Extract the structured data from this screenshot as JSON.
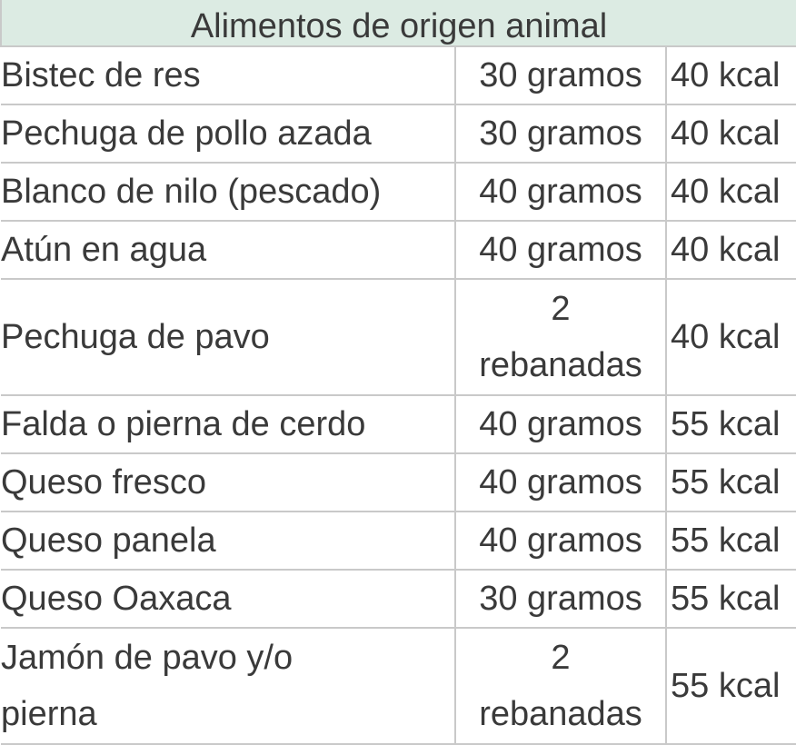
{
  "table": {
    "header": "Alimentos de origen animal",
    "rows": [
      {
        "name": "Bistec de res",
        "quantity": "30 gramos",
        "kcal": "40 kcal"
      },
      {
        "name": "Pechuga de pollo azada",
        "quantity": "30 gramos",
        "kcal": "40 kcal"
      },
      {
        "name": "Blanco de nilo (pescado)",
        "quantity": "40 gramos",
        "kcal": "40 kcal"
      },
      {
        "name": "Atún en agua",
        "quantity": "40 gramos",
        "kcal": "40 kcal"
      },
      {
        "name": "Pechuga de pavo",
        "quantity_line1": "2",
        "quantity_line2": "rebanadas",
        "kcal": "40 kcal"
      },
      {
        "name": "Falda o pierna de cerdo",
        "quantity": "40 gramos",
        "kcal": "55 kcal"
      },
      {
        "name": "Queso fresco",
        "quantity": "40 gramos",
        "kcal": "55 kcal"
      },
      {
        "name": "Queso panela",
        "quantity": "40 gramos",
        "kcal": "55 kcal"
      },
      {
        "name": "Queso Oaxaca",
        "quantity": "30 gramos",
        "kcal": "55 kcal"
      },
      {
        "name_line1": "Jamón de pavo y/o",
        "name_line2": "pierna",
        "quantity_line1": "2",
        "quantity_line2": "rebanadas",
        "kcal": "55 kcal"
      }
    ]
  },
  "colors": {
    "header_bg": "#dcebe3",
    "border": "#c9c9c9",
    "text": "#3a3a3a"
  }
}
